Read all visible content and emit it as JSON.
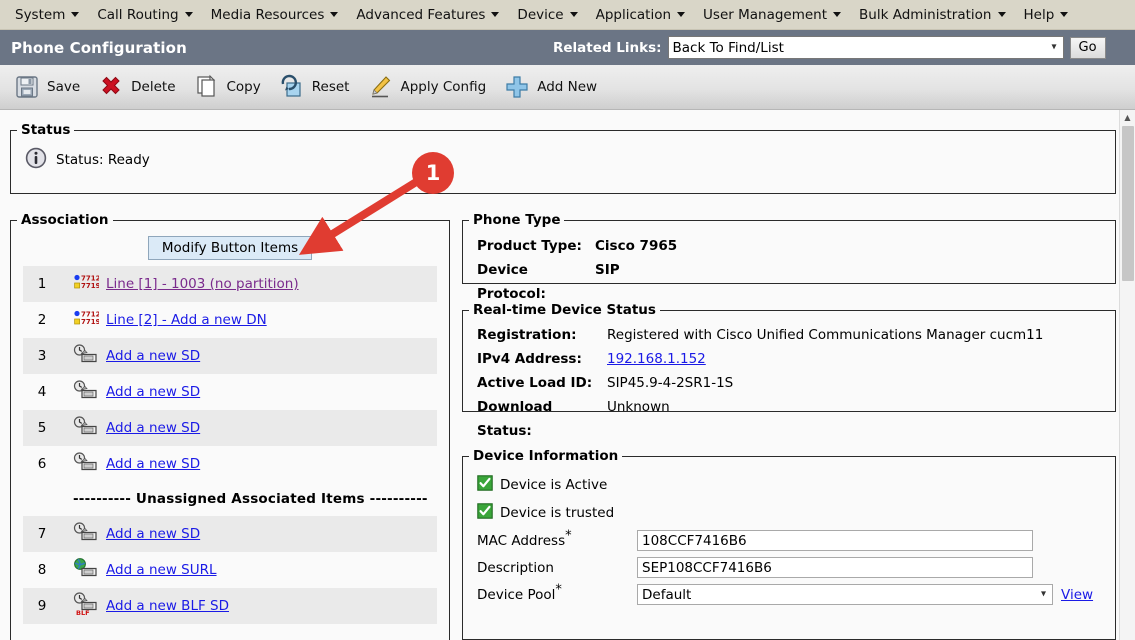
{
  "menubar": {
    "items": [
      {
        "label": "System",
        "icon": "chevron-down-icon"
      },
      {
        "label": "Call Routing",
        "icon": "chevron-down-icon"
      },
      {
        "label": "Media Resources",
        "icon": "chevron-down-icon"
      },
      {
        "label": "Advanced Features",
        "icon": "chevron-down-icon"
      },
      {
        "label": "Device",
        "icon": "chevron-down-icon"
      },
      {
        "label": "Application",
        "icon": "chevron-down-icon"
      },
      {
        "label": "User Management",
        "icon": "chevron-down-icon"
      },
      {
        "label": "Bulk Administration",
        "icon": "chevron-down-icon"
      },
      {
        "label": "Help",
        "icon": "chevron-down-icon"
      }
    ]
  },
  "header": {
    "title": "Phone Configuration",
    "related_links_label": "Related Links:",
    "related_links_value": "Back To Find/List",
    "go_label": "Go",
    "bar_color": "#6b7585"
  },
  "toolbar": {
    "items": [
      {
        "label": "Save",
        "icon": "floppy-save-icon"
      },
      {
        "label": "Delete",
        "icon": "red-x-delete-icon"
      },
      {
        "label": "Copy",
        "icon": "copy-pages-icon"
      },
      {
        "label": "Reset",
        "icon": "reset-refresh-icon"
      },
      {
        "label": "Apply Config",
        "icon": "pencil-apply-icon"
      },
      {
        "label": "Add New",
        "icon": "blue-plus-add-icon"
      }
    ]
  },
  "status_panel": {
    "legend": "Status",
    "icon": "info-icon",
    "text": "Status: Ready"
  },
  "association": {
    "legend": "Association",
    "modify_button": "Modify Button Items",
    "divider_text": "---------- Unassigned Associated Items ----------",
    "divider_after_index": 6,
    "rows": [
      {
        "index": "1",
        "label": "Line [1] - 1003 (no partition)",
        "icon": "phone-line-icon",
        "visited": true
      },
      {
        "index": "2",
        "label": "Line [2] - Add a new DN",
        "icon": "phone-line-icon",
        "visited": false
      },
      {
        "index": "3",
        "label": "Add a new SD",
        "icon": "speed-dial-icon",
        "visited": false
      },
      {
        "index": "4",
        "label": "Add a new SD",
        "icon": "speed-dial-icon",
        "visited": false
      },
      {
        "index": "5",
        "label": "Add a new SD",
        "icon": "speed-dial-icon",
        "visited": false
      },
      {
        "index": "6",
        "label": "Add a new SD",
        "icon": "speed-dial-icon",
        "visited": false
      },
      {
        "index": "7",
        "label": "Add a new SD",
        "icon": "speed-dial-icon",
        "visited": false
      },
      {
        "index": "8",
        "label": "Add a new SURL",
        "icon": "service-url-globe-icon",
        "visited": false
      },
      {
        "index": "9",
        "label": "Add a new BLF SD",
        "icon": "blf-speed-dial-icon",
        "visited": false
      }
    ]
  },
  "phone_type": {
    "legend": "Phone Type",
    "product_type_label": "Product Type:",
    "product_type_value": "Cisco 7965",
    "device_protocol_label": "Device Protocol:",
    "device_protocol_value": "SIP"
  },
  "realtime_status": {
    "legend": "Real-time Device Status",
    "registration_label": "Registration:",
    "registration_value": "Registered with Cisco Unified Communications Manager cucm11",
    "ipv4_label": "IPv4 Address:",
    "ipv4_value": "192.168.1.152",
    "active_load_label": "Active Load ID:",
    "active_load_value": "SIP45.9-4-2SR1-1S",
    "download_label": "Download Status:",
    "download_value": "Unknown"
  },
  "device_information": {
    "legend": "Device Information",
    "device_active_label": "Device is Active",
    "device_active_icon": "green-check-icon",
    "device_trusted_label": "Device is trusted",
    "device_trusted_icon": "green-check-icon",
    "mac_label": "MAC Address",
    "mac_value": "108CCF7416B6",
    "description_label": "Description",
    "description_value": "SEP108CCF7416B6",
    "device_pool_label": "Device Pool",
    "device_pool_value": "Default",
    "view_link": "View",
    "required_marker": "*"
  },
  "annotation": {
    "badge_number": "1",
    "badge_color": "#e03c31",
    "target": "modify-button-items-button"
  },
  "scrollbar": {
    "up_arrow_icon": "scroll-up-arrow-icon"
  }
}
